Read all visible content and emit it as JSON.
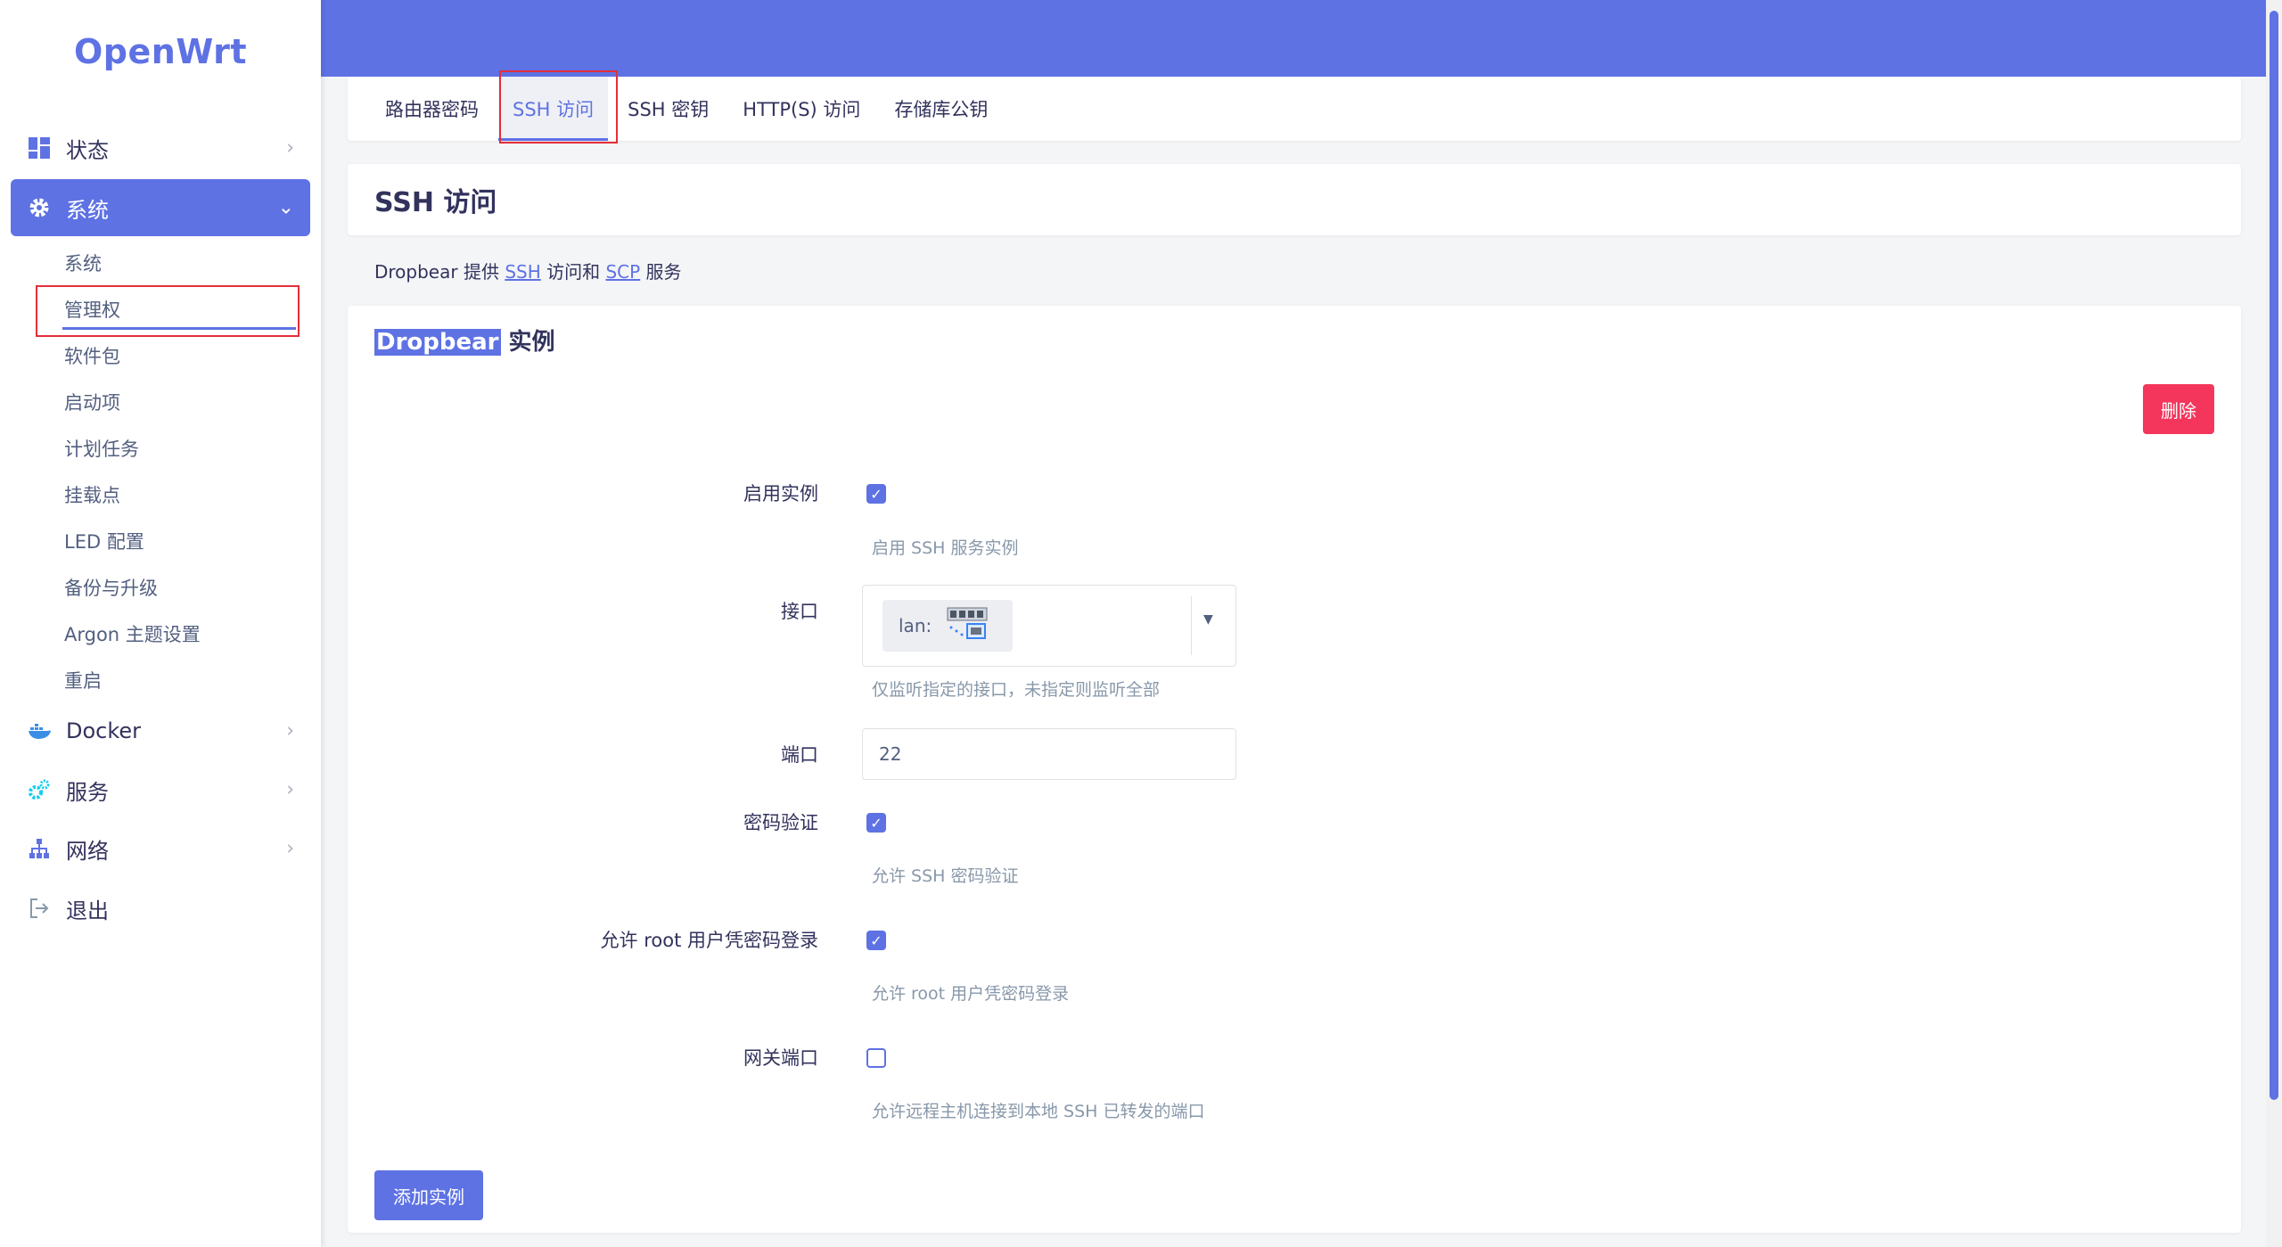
{
  "app": {
    "logo": "OpenWrt"
  },
  "sidebar": {
    "items": [
      {
        "label": "状态",
        "icon": "dashboard-icon"
      },
      {
        "label": "系统",
        "icon": "gear-icon",
        "active": true
      },
      {
        "label": "Docker",
        "icon": "docker-icon"
      },
      {
        "label": "服务",
        "icon": "services-icon"
      },
      {
        "label": "网络",
        "icon": "network-icon"
      },
      {
        "label": "退出",
        "icon": "logout-icon"
      }
    ],
    "sub_items": [
      "系统",
      "管理权",
      "软件包",
      "启动项",
      "计划任务",
      "挂载点",
      "LED 配置",
      "备份与升级",
      "Argon 主题设置",
      "重启"
    ]
  },
  "tabs": [
    "路由器密码",
    "SSH 访问",
    "SSH 密钥",
    "HTTP(S) 访问",
    "存储库公钥"
  ],
  "page": {
    "title": "SSH 访问",
    "desc_prefix": "Dropbear 提供 ",
    "desc_ssh": "SSH",
    "desc_mid": " 访问和 ",
    "desc_scp": "SCP",
    "desc_suffix": " 服务"
  },
  "section": {
    "title_sel": "Dropbear",
    "title_rest": " 实例",
    "delete_label": "删除",
    "add_label": "添加实例"
  },
  "form": {
    "enable_label": "启用实例",
    "enable_checked": true,
    "enable_hint": "启用 SSH 服务实例",
    "iface_label": "接口",
    "iface_value": "lan:",
    "iface_hint": "仅监听指定的接口，未指定则监听全部",
    "port_label": "端口",
    "port_value": "22",
    "pwauth_label": "密码验证",
    "pwauth_checked": true,
    "pwauth_hint": "允许 SSH 密码验证",
    "root_label": "允许 root 用户凭密码登录",
    "root_checked": true,
    "root_hint": "允许 root 用户凭密码登录",
    "gw_label": "网关端口",
    "gw_checked": false,
    "gw_hint": "允许远程主机连接到本地 SSH 已转发的端口"
  },
  "colors": {
    "accent": "#5e72e4",
    "danger": "#f5365c",
    "highlight": "#e52e3a"
  }
}
